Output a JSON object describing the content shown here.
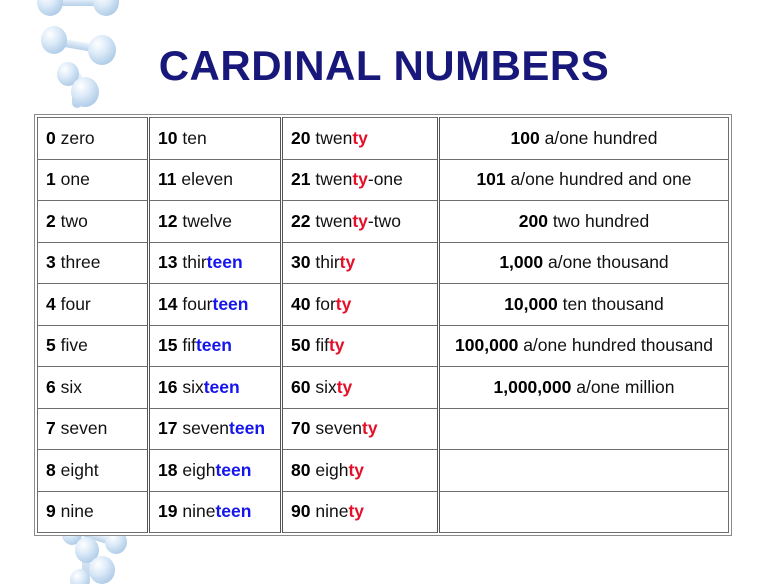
{
  "slide": {
    "title": "CARDINAL NUMBERS",
    "title_color": "#18187a",
    "background_color": "#ffffff"
  },
  "decorations": [
    {
      "name": "molecule-top-left",
      "color": "#c3d9ee"
    },
    {
      "name": "molecule-bottom-left",
      "color": "#c3d9ee"
    }
  ],
  "colors": {
    "teen_suffix": "#1515ee",
    "ty_suffix": "#e4102a",
    "number": "#000000",
    "word": "#111111",
    "border": "#6e6e6e"
  },
  "table": {
    "columns": 4,
    "rows": 10,
    "cells": [
      [
        {
          "number": "0",
          "stem": "zero",
          "suffix": "",
          "suffix_type": "none"
        },
        {
          "number": "10",
          "stem": "ten",
          "suffix": "",
          "suffix_type": "none"
        },
        {
          "number": "20",
          "stem": "twen",
          "suffix": "ty",
          "suffix_type": "ty",
          "tail": ""
        },
        {
          "number": "100",
          "stem": "a/one hundred",
          "suffix": "",
          "suffix_type": "none"
        }
      ],
      [
        {
          "number": "1",
          "stem": "one",
          "suffix": "",
          "suffix_type": "none"
        },
        {
          "number": "11",
          "stem": "eleven",
          "suffix": "",
          "suffix_type": "none"
        },
        {
          "number": "21",
          "stem": "twen",
          "suffix": "ty",
          "suffix_type": "ty",
          "tail": "-one"
        },
        {
          "number": "101",
          "stem": "a/one hundred and one",
          "suffix": "",
          "suffix_type": "none"
        }
      ],
      [
        {
          "number": "2",
          "stem": "two",
          "suffix": "",
          "suffix_type": "none"
        },
        {
          "number": "12",
          "stem": "twelve",
          "suffix": "",
          "suffix_type": "none"
        },
        {
          "number": "22",
          "stem": "twen",
          "suffix": "ty",
          "suffix_type": "ty",
          "tail": "-two"
        },
        {
          "number": "200",
          "stem": "two hundred",
          "suffix": "",
          "suffix_type": "none"
        }
      ],
      [
        {
          "number": "3",
          "stem": "three",
          "suffix": "",
          "suffix_type": "none"
        },
        {
          "number": "13",
          "stem": "thir",
          "suffix": "teen",
          "suffix_type": "teen",
          "tail": ""
        },
        {
          "number": "30",
          "stem": "thir",
          "suffix": "ty",
          "suffix_type": "ty",
          "tail": ""
        },
        {
          "number": "1,000",
          "stem": "a/one thousand",
          "suffix": "",
          "suffix_type": "none"
        }
      ],
      [
        {
          "number": "4",
          "stem": "four",
          "suffix": "",
          "suffix_type": "none"
        },
        {
          "number": "14",
          "stem": "four",
          "suffix": "teen",
          "suffix_type": "teen",
          "tail": ""
        },
        {
          "number": "40",
          "stem": "for",
          "suffix": "ty",
          "suffix_type": "ty",
          "tail": ""
        },
        {
          "number": "10,000",
          "stem": "ten thousand",
          "suffix": "",
          "suffix_type": "none"
        }
      ],
      [
        {
          "number": "5",
          "stem": "five",
          "suffix": "",
          "suffix_type": "none"
        },
        {
          "number": "15",
          "stem": "fif",
          "suffix": "teen",
          "suffix_type": "teen",
          "tail": ""
        },
        {
          "number": "50",
          "stem": "fif",
          "suffix": "ty",
          "suffix_type": "ty",
          "tail": ""
        },
        {
          "number": "100,000",
          "stem": "a/one hundred thousand",
          "suffix": "",
          "suffix_type": "none"
        }
      ],
      [
        {
          "number": "6",
          "stem": "six",
          "suffix": "",
          "suffix_type": "none"
        },
        {
          "number": "16",
          "stem": "six",
          "suffix": "teen",
          "suffix_type": "teen",
          "tail": ""
        },
        {
          "number": "60",
          "stem": "six",
          "suffix": "ty",
          "suffix_type": "ty",
          "tail": ""
        },
        {
          "number": "1,000,000",
          "stem": "a/one million",
          "suffix": "",
          "suffix_type": "none"
        }
      ],
      [
        {
          "number": "7",
          "stem": "seven",
          "suffix": "",
          "suffix_type": "none"
        },
        {
          "number": "17",
          "stem": "seven",
          "suffix": "teen",
          "suffix_type": "teen",
          "tail": ""
        },
        {
          "number": "70",
          "stem": "seven",
          "suffix": "ty",
          "suffix_type": "ty",
          "tail": ""
        },
        {
          "number": "",
          "stem": "",
          "suffix": "",
          "suffix_type": "none"
        }
      ],
      [
        {
          "number": "8",
          "stem": "eight",
          "suffix": "",
          "suffix_type": "none"
        },
        {
          "number": "18",
          "stem": "eigh",
          "suffix": "teen",
          "suffix_type": "teen",
          "tail": ""
        },
        {
          "number": "80",
          "stem": "eigh",
          "suffix": "ty",
          "suffix_type": "ty",
          "tail": ""
        },
        {
          "number": "",
          "stem": "",
          "suffix": "",
          "suffix_type": "none"
        }
      ],
      [
        {
          "number": "9",
          "stem": "nine",
          "suffix": "",
          "suffix_type": "none"
        },
        {
          "number": "19",
          "stem": "nine",
          "suffix": "teen",
          "suffix_type": "teen",
          "tail": ""
        },
        {
          "number": "90",
          "stem": "nine",
          "suffix": "ty",
          "suffix_type": "ty",
          "tail": ""
        },
        {
          "number": "",
          "stem": "",
          "suffix": "",
          "suffix_type": "none"
        }
      ]
    ]
  }
}
